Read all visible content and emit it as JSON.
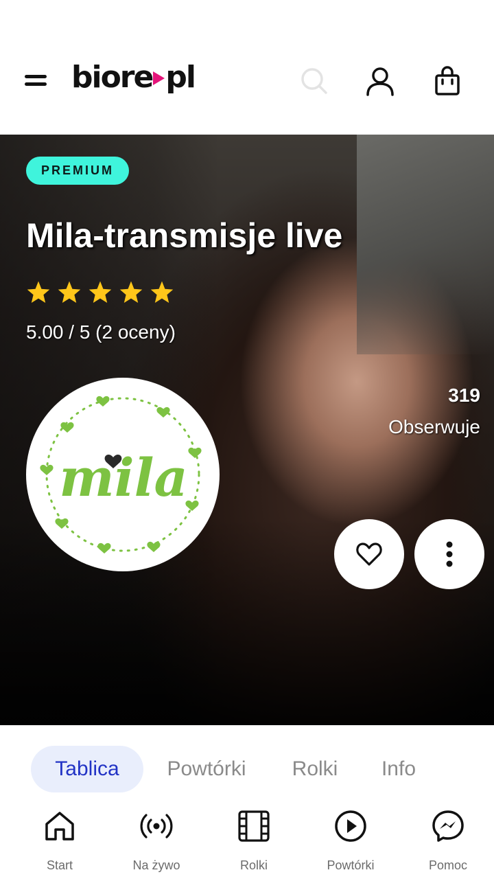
{
  "header": {
    "logo_main": "biore",
    "logo_suffix": "pl",
    "icons": [
      "menu-icon",
      "search-icon",
      "user-icon",
      "shopping-bag-icon"
    ],
    "brand_accent": "#e5157a"
  },
  "hero": {
    "badge": "PREMIUM",
    "badge_color": "#3ff4dc",
    "title": "Mila-transmisje live",
    "stars_filled": 5,
    "stars_total": 5,
    "star_color": "#ffc61a",
    "rating_text": "5.00 / 5 (2 oceny)",
    "avatar_text": "mila",
    "avatar_color": "#7dc242",
    "followers_count": "319",
    "followers_label": "Obserwuje"
  },
  "tabs": [
    {
      "label": "Tablica",
      "active": true
    },
    {
      "label": "Powtórki",
      "active": false
    },
    {
      "label": "Rolki",
      "active": false
    },
    {
      "label": "Info",
      "active": false
    }
  ],
  "tabs_active_color": "#2233c5",
  "nav": [
    {
      "label": "Start",
      "icon": "home-icon"
    },
    {
      "label": "Na żywo",
      "icon": "live-broadcast-icon"
    },
    {
      "label": "Rolki",
      "icon": "film-reel-icon"
    },
    {
      "label": "Powtórki",
      "icon": "play-circle-icon"
    },
    {
      "label": "Pomoc",
      "icon": "messenger-icon"
    }
  ]
}
